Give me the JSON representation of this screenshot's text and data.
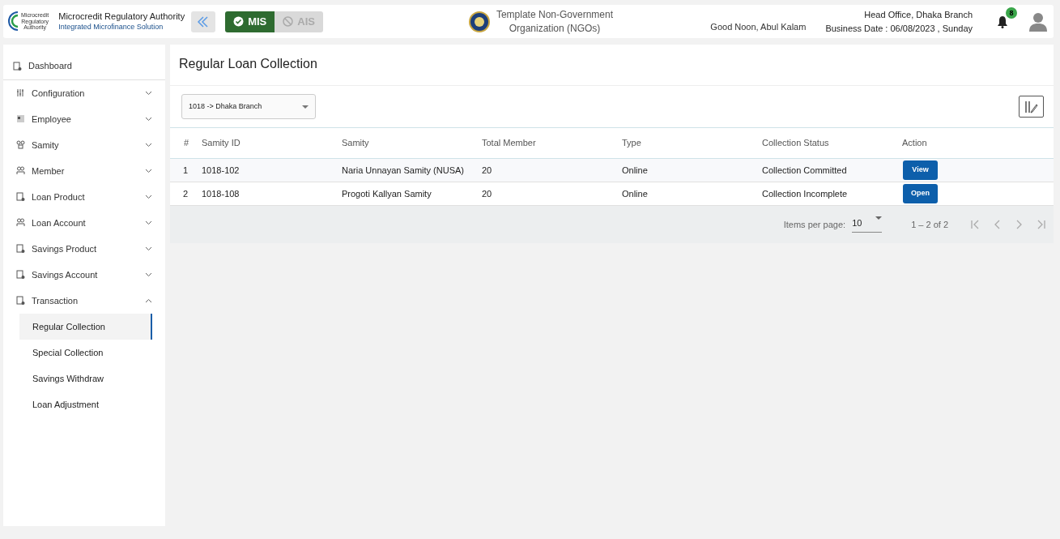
{
  "header": {
    "logo_caption": [
      "Microcredit",
      "Regulatory",
      "Authority"
    ],
    "org_name": "Microcredit Regulatory Authority",
    "org_subtitle": "Integrated Microfinance Solution",
    "modes": [
      {
        "label": "MIS",
        "selected": true
      },
      {
        "label": "AIS",
        "selected": false
      }
    ],
    "ngo_name": [
      "Template Non-Government",
      "Organization (NGOs)"
    ],
    "greeting": "Good Noon, Abul Kalam",
    "office": "Head Office, Dhaka Branch",
    "business_date": "Business Date : 06/08/2023 , Sunday",
    "notification_count": "8"
  },
  "sidebar": {
    "items": [
      {
        "label": "Dashboard",
        "kind": "link"
      },
      {
        "label": "Configuration",
        "kind": "menu",
        "expanded": false
      },
      {
        "label": "Employee",
        "kind": "menu",
        "expanded": false
      },
      {
        "label": "Samity",
        "kind": "menu",
        "expanded": false
      },
      {
        "label": "Member",
        "kind": "menu",
        "expanded": false
      },
      {
        "label": "Loan Product",
        "kind": "menu",
        "expanded": false
      },
      {
        "label": "Loan Account",
        "kind": "menu",
        "expanded": false
      },
      {
        "label": "Savings Product",
        "kind": "menu",
        "expanded": false
      },
      {
        "label": "Savings Account",
        "kind": "menu",
        "expanded": false
      },
      {
        "label": "Transaction",
        "kind": "menu",
        "expanded": true,
        "children": [
          {
            "label": "Regular Collection",
            "selected": true
          },
          {
            "label": "Special Collection",
            "selected": false
          },
          {
            "label": "Savings Withdraw",
            "selected": false
          },
          {
            "label": "Loan Adjustment",
            "selected": false
          }
        ]
      }
    ]
  },
  "page": {
    "title": "Regular Loan Collection",
    "branch_select": "1018 -> Dhaka Branch",
    "table": {
      "columns": [
        "#",
        "Samity ID",
        "Samity",
        "Total Member",
        "Type",
        "Collection Status",
        "Action"
      ],
      "rows": [
        {
          "cells": [
            "1",
            "1018-102",
            "Naria Unnayan Samity (NUSA)",
            "20",
            "Online",
            "Collection Committed"
          ],
          "action": "View"
        },
        {
          "cells": [
            "2",
            "1018-108",
            "Progoti Kallyan Samity",
            "20",
            "Online",
            "Collection Incomplete"
          ],
          "action": "Open"
        }
      ]
    },
    "paginator": {
      "items_label": "Items per page:",
      "page_size": "10",
      "range": "1 – 2 of 2"
    }
  }
}
